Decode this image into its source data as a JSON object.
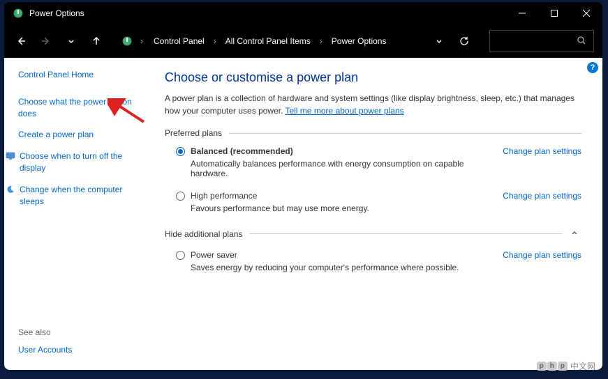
{
  "window": {
    "title": "Power Options"
  },
  "breadcrumb": {
    "items": [
      "Control Panel",
      "All Control Panel Items",
      "Power Options"
    ]
  },
  "sidebar": {
    "home": "Control Panel Home",
    "links": [
      "Choose what the power button does",
      "Create a power plan",
      "Choose when to turn off the display",
      "Change when the computer sleeps"
    ],
    "see_also_title": "See also",
    "see_also_link": "User Accounts"
  },
  "main": {
    "title": "Choose or customise a power plan",
    "description": "A power plan is a collection of hardware and system settings (like display brightness, sleep, etc.) that manages how your computer uses power. ",
    "learn_more": "Tell me more about power plans",
    "preferred_header": "Preferred plans",
    "hide_header": "Hide additional plans",
    "change_link": "Change plan settings",
    "plans": [
      {
        "name": "Balanced (recommended)",
        "desc": "Automatically balances performance with energy consumption on capable hardware.",
        "selected": true,
        "bold": true
      },
      {
        "name": "High performance",
        "desc": "Favours performance but may use more energy.",
        "selected": false,
        "bold": false
      }
    ],
    "additional_plans": [
      {
        "name": "Power saver",
        "desc": "Saves energy by reducing your computer's performance where possible.",
        "selected": false,
        "bold": false
      }
    ]
  },
  "help": "?",
  "watermark": "中文网"
}
